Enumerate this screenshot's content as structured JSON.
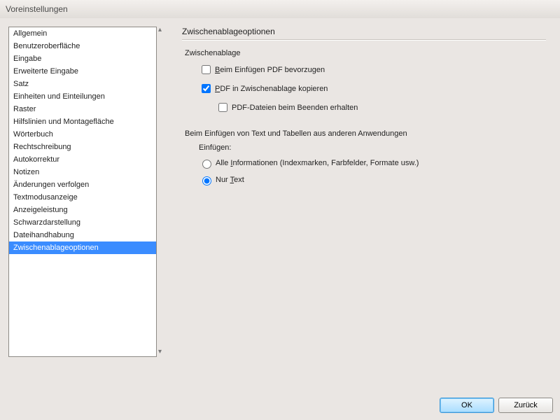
{
  "window": {
    "title": "Voreinstellungen"
  },
  "sidebar": {
    "items": [
      "Allgemein",
      "Benutzeroberfläche",
      "Eingabe",
      "Erweiterte Eingabe",
      "Satz",
      "Einheiten und Einteilungen",
      "Raster",
      "Hilfslinien und Montagefläche",
      "Wörterbuch",
      "Rechtschreibung",
      "Autokorrektur",
      "Notizen",
      "Änderungen verfolgen",
      "Textmodusanzeige",
      "Anzeigeleistung",
      "Schwarzdarstellung",
      "Dateihandhabung",
      "Zwischenablageoptionen"
    ],
    "selected_index": 17
  },
  "main": {
    "title": "Zwischenablageoptionen",
    "clipboard_group": {
      "label": "Zwischenablage",
      "prefer_pdf": {
        "label_pre": "",
        "label_u": "B",
        "label_post": "eim Einfügen PDF bevorzugen",
        "checked": false
      },
      "copy_pdf": {
        "label_pre": "",
        "label_u": "P",
        "label_post": "DF in Zwischenablage kopieren",
        "checked": true
      },
      "keep_pdf_files": {
        "label": "PDF-Dateien beim Beenden erhalten",
        "checked": false
      }
    },
    "paste_group": {
      "label": "Beim Einfügen von Text und Tabellen aus anderen Anwendungen",
      "sub_label": "Einfügen:",
      "opt_all": {
        "label_pre": "Alle ",
        "label_u": "I",
        "label_post": "nformationen (Indexmarken, Farbfelder, Formate usw.)"
      },
      "opt_text": {
        "label_pre": "Nur ",
        "label_u": "T",
        "label_post": "ext"
      },
      "selected": "text"
    }
  },
  "buttons": {
    "ok": "OK",
    "back": "Zurück"
  }
}
